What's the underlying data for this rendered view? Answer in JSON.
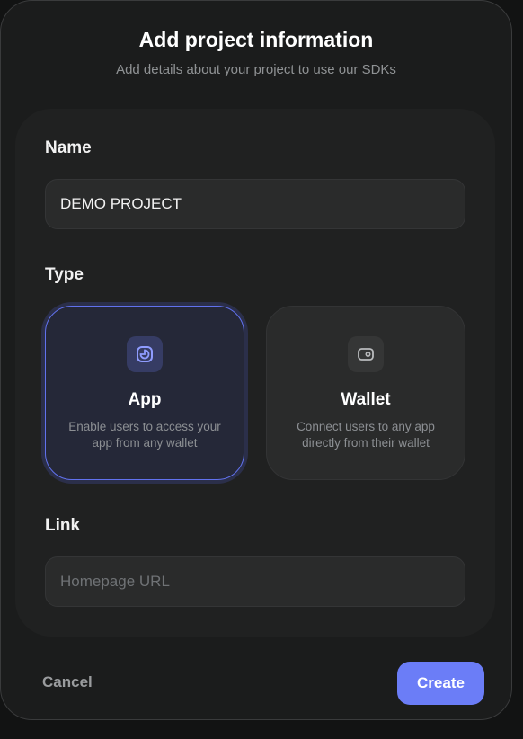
{
  "header": {
    "title": "Add project information",
    "subtitle": "Add details about your project to use our SDKs"
  },
  "form": {
    "name": {
      "label": "Name",
      "value": "DEMO PROJECT"
    },
    "type": {
      "label": "Type",
      "selected": "App",
      "options": [
        {
          "title": "App",
          "description": "Enable users to access your app from any wallet",
          "icon": "app-icon",
          "selected": true
        },
        {
          "title": "Wallet",
          "description": "Connect users to any app directly from their wallet",
          "icon": "wallet-icon",
          "selected": false
        }
      ]
    },
    "link": {
      "label": "Link",
      "value": "",
      "placeholder": "Homepage URL"
    }
  },
  "footer": {
    "cancel_label": "Cancel",
    "create_label": "Create"
  },
  "colors": {
    "accent": "#6b7df7",
    "selected_border": "#6172ee",
    "background": "#1b1c1c",
    "panel": "#202121"
  }
}
